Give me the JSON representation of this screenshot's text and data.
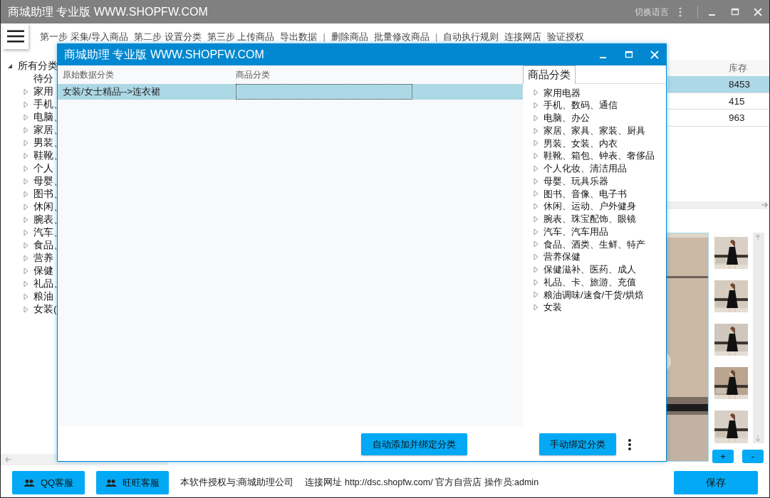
{
  "window": {
    "title": "商城助理 专业版 WWW.SHOPFW.COM",
    "language_button": "切换语言"
  },
  "toolbar": {
    "items": [
      {
        "kind": "link",
        "label": "第一步 采集/导入商品"
      },
      {
        "kind": "link",
        "label": "第二步 设置分类"
      },
      {
        "kind": "link",
        "label": "第三步 上传商品"
      },
      {
        "kind": "link",
        "label": "导出数据"
      },
      {
        "kind": "separator",
        "label": "|"
      },
      {
        "kind": "link",
        "label": "删除商品"
      },
      {
        "kind": "link",
        "label": "批量修改商品"
      },
      {
        "kind": "separator",
        "label": "|"
      },
      {
        "kind": "link",
        "label": "自动执行规则"
      },
      {
        "kind": "link",
        "label": "连接网店"
      },
      {
        "kind": "link",
        "label": "验证授权"
      }
    ]
  },
  "category_tree": {
    "label": "所有分类",
    "expanded": true,
    "children": [
      {
        "label": "待分",
        "expandable": false
      },
      {
        "label": "家用",
        "expandable": true
      },
      {
        "label": "手机、",
        "expandable": true
      },
      {
        "label": "电脑、",
        "expandable": true
      },
      {
        "label": "家居、",
        "expandable": true
      },
      {
        "label": "男装、",
        "expandable": true
      },
      {
        "label": "鞋靴、",
        "expandable": true
      },
      {
        "label": "个人",
        "expandable": true
      },
      {
        "label": "母婴、",
        "expandable": true
      },
      {
        "label": "图书、",
        "expandable": true
      },
      {
        "label": "休闲、",
        "expandable": true
      },
      {
        "label": "腕表、",
        "expandable": true
      },
      {
        "label": "汽车、",
        "expandable": true
      },
      {
        "label": "食品、",
        "expandable": true
      },
      {
        "label": "营养",
        "expandable": true
      },
      {
        "label": "保健",
        "expandable": true
      },
      {
        "label": "礼品、",
        "expandable": true
      },
      {
        "label": "粮油",
        "expandable": true
      },
      {
        "label": "女装(",
        "expandable": true
      }
    ]
  },
  "product_table": {
    "columns": [
      "库存"
    ],
    "rows": [
      {
        "stock": "8453",
        "selected": true
      },
      {
        "stock": "415",
        "selected": false
      },
      {
        "stock": "963",
        "selected": false
      }
    ]
  },
  "image_panel": {
    "add_button": "+",
    "remove_button": "-"
  },
  "dialog": {
    "title": "商城助理 专业版 WWW.SHOPFW.COM",
    "grid": {
      "columns": [
        "原始数据分类",
        "商品分类"
      ],
      "rows": [
        {
          "source": "女装/女士精品-->连衣裙",
          "selected": true
        }
      ]
    },
    "category_panel": {
      "tab": "商品分类",
      "items": [
        {
          "label": "家用电器",
          "expandable": true
        },
        {
          "label": "手机、数码、通信",
          "expandable": true
        },
        {
          "label": "电脑、办公",
          "expandable": true
        },
        {
          "label": "家居、家具、家装、厨具",
          "expandable": true
        },
        {
          "label": "男装、女装、内衣",
          "expandable": true
        },
        {
          "label": "鞋靴、箱包、钟表、奢侈品",
          "expandable": true
        },
        {
          "label": "个人化妆、清洁用品",
          "expandable": true
        },
        {
          "label": "母婴、玩具乐器",
          "expandable": true
        },
        {
          "label": "图书、音像、电子书",
          "expandable": true
        },
        {
          "label": "休闲、运动、户外健身",
          "expandable": true
        },
        {
          "label": "腕表、珠宝配饰、眼镜",
          "expandable": true
        },
        {
          "label": "汽车、汽车用品",
          "expandable": true
        },
        {
          "label": "食品、酒类、生鲜、特产",
          "expandable": true
        },
        {
          "label": "营养保健",
          "expandable": true
        },
        {
          "label": "保健滋补、医药、成人",
          "expandable": true
        },
        {
          "label": "礼品、卡、旅游、充值",
          "expandable": true
        },
        {
          "label": "粮油调味/速食/干货/烘焙",
          "expandable": true
        },
        {
          "label": "女装",
          "expandable": true
        }
      ]
    },
    "buttons": [
      "自动添加并绑定分类",
      "手动绑定分类"
    ]
  },
  "footer": {
    "support_buttons": [
      "QQ客服",
      "旺旺客服"
    ],
    "license": "本软件授权与:商城助理公司",
    "connection": "连接网址 http://dsc.shopfw.com/ 官方自营店 操作员:admin",
    "save_button": "保存"
  }
}
